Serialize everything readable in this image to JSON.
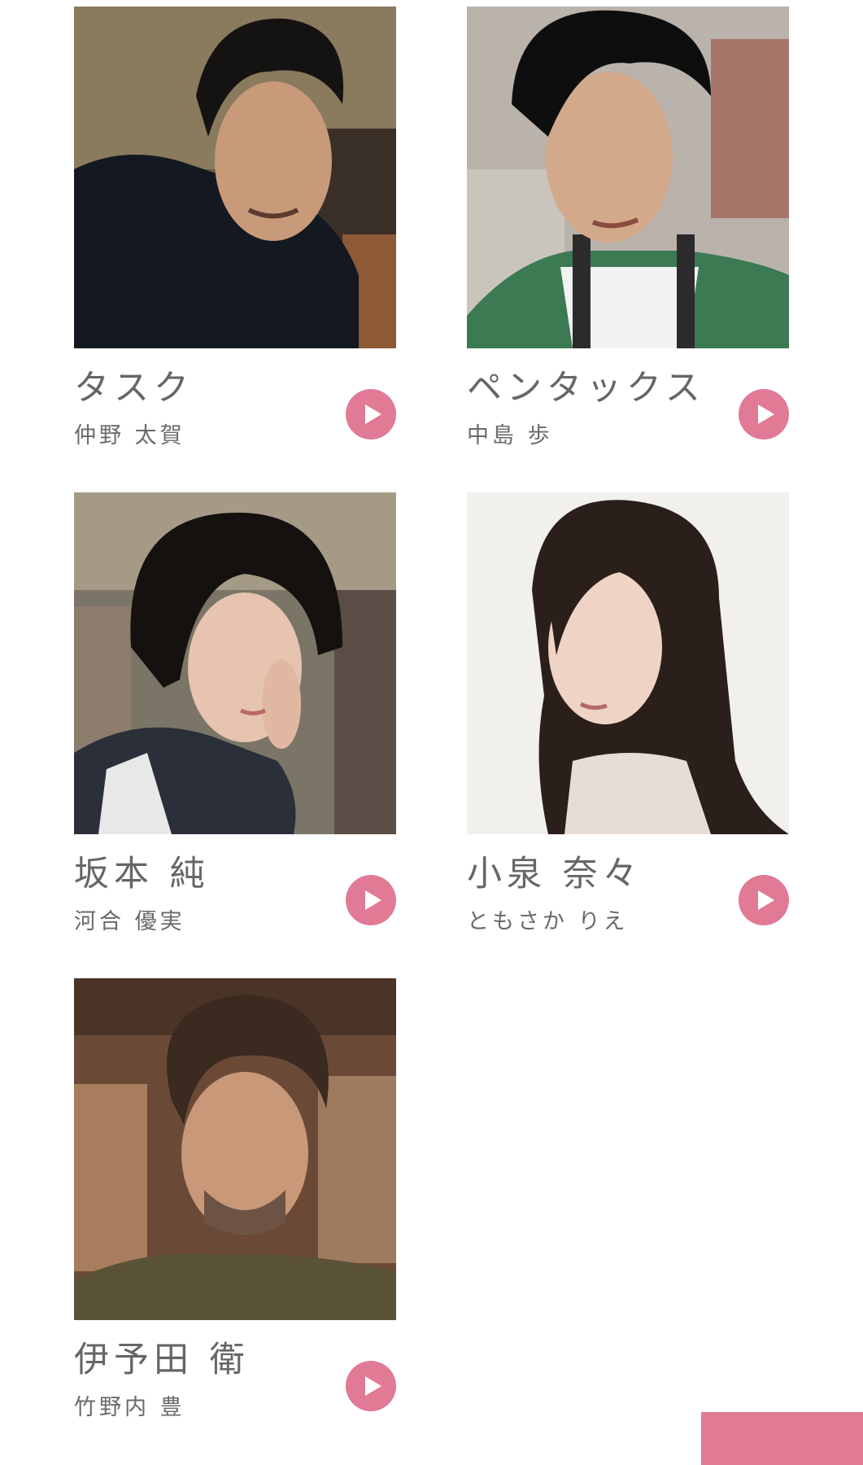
{
  "cast": [
    {
      "role": "タスク",
      "actor": "仲野 太賀",
      "photo_desc": "man-dark-tshirt-bar"
    },
    {
      "role": "ペンタックス",
      "actor": "中島 歩",
      "photo_desc": "man-camera-strap-green-cardigan"
    },
    {
      "role": "坂本 純",
      "actor": "河合 優実",
      "photo_desc": "woman-short-hair-plaid-vest"
    },
    {
      "role": "小泉 奈々",
      "actor": "ともさか りえ",
      "photo_desc": "woman-long-hair-white-background"
    },
    {
      "role": "伊予田 衛",
      "actor": "竹野内 豊",
      "photo_desc": "man-beard-olive-sweater-shop"
    }
  ],
  "colors": {
    "accent": "#e07a95",
    "text": "#666666"
  },
  "icons": {
    "play": "play-icon"
  }
}
